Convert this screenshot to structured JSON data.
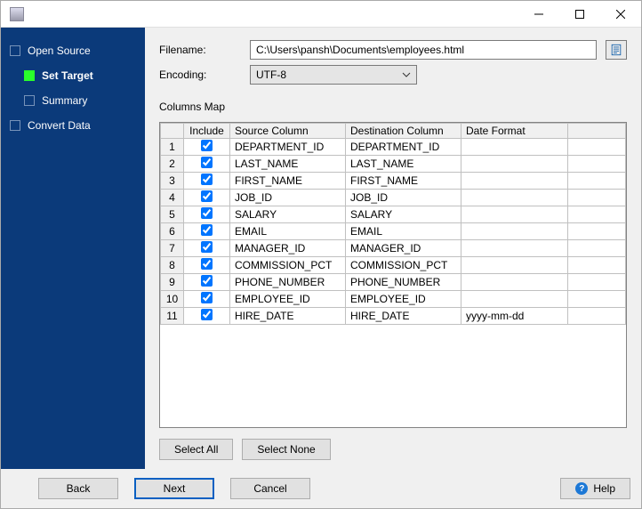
{
  "window": {
    "title": ""
  },
  "sidebar": {
    "items": [
      {
        "label": "Open Source",
        "active": false
      },
      {
        "label": "Set Target",
        "active": true
      },
      {
        "label": "Summary",
        "active": false
      },
      {
        "label": "Convert Data",
        "active": false
      }
    ]
  },
  "form": {
    "filename_label": "Filename:",
    "filename_value": "C:\\Users\\pansh\\Documents\\employees.html",
    "encoding_label": "Encoding:",
    "encoding_value": "UTF-8",
    "columns_map_label": "Columns Map"
  },
  "table": {
    "headers": {
      "include": "Include",
      "source": "Source Column",
      "dest": "Destination Column",
      "format": "Date Format"
    },
    "rows": [
      {
        "n": "1",
        "include": true,
        "source": "DEPARTMENT_ID",
        "dest": "DEPARTMENT_ID",
        "format": ""
      },
      {
        "n": "2",
        "include": true,
        "source": "LAST_NAME",
        "dest": "LAST_NAME",
        "format": ""
      },
      {
        "n": "3",
        "include": true,
        "source": "FIRST_NAME",
        "dest": "FIRST_NAME",
        "format": ""
      },
      {
        "n": "4",
        "include": true,
        "source": "JOB_ID",
        "dest": "JOB_ID",
        "format": ""
      },
      {
        "n": "5",
        "include": true,
        "source": "SALARY",
        "dest": "SALARY",
        "format": ""
      },
      {
        "n": "6",
        "include": true,
        "source": "EMAIL",
        "dest": "EMAIL",
        "format": ""
      },
      {
        "n": "7",
        "include": true,
        "source": "MANAGER_ID",
        "dest": "MANAGER_ID",
        "format": ""
      },
      {
        "n": "8",
        "include": true,
        "source": "COMMISSION_PCT",
        "dest": "COMMISSION_PCT",
        "format": ""
      },
      {
        "n": "9",
        "include": true,
        "source": "PHONE_NUMBER",
        "dest": "PHONE_NUMBER",
        "format": ""
      },
      {
        "n": "10",
        "include": true,
        "source": "EMPLOYEE_ID",
        "dest": "EMPLOYEE_ID",
        "format": ""
      },
      {
        "n": "11",
        "include": true,
        "source": "HIRE_DATE",
        "dest": "HIRE_DATE",
        "format": "yyyy-mm-dd"
      }
    ]
  },
  "buttons": {
    "select_all": "Select All",
    "select_none": "Select None",
    "back": "Back",
    "next": "Next",
    "cancel": "Cancel",
    "help": "Help"
  }
}
